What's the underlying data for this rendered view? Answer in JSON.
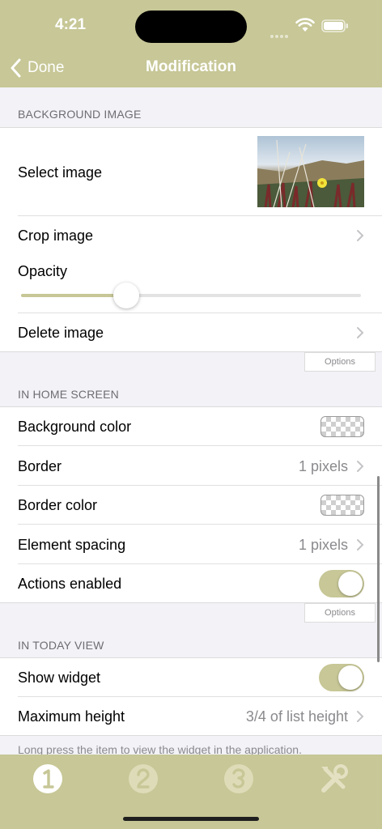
{
  "status_bar": {
    "time": "4:21"
  },
  "nav": {
    "back_label": "Done",
    "title": "Modification"
  },
  "background_image": {
    "header": "BACKGROUND IMAGE",
    "select_label": "Select image",
    "crop_label": "Crop image",
    "opacity_label": "Opacity",
    "opacity_value": 0.31,
    "delete_label": "Delete image",
    "options_label": "Options"
  },
  "home_screen": {
    "header": "IN HOME SCREEN",
    "background_color_label": "Background color",
    "border_label": "Border",
    "border_value": "1 pixels",
    "border_color_label": "Border color",
    "spacing_label": "Element spacing",
    "spacing_value": "1 pixels",
    "actions_label": "Actions enabled",
    "actions_enabled": true,
    "options_label": "Options"
  },
  "today_view": {
    "header": "IN TODAY VIEW",
    "show_widget_label": "Show widget",
    "show_widget": true,
    "max_height_label": "Maximum height",
    "max_height_value": "3/4 of list height",
    "note": "Long press the item to view the widget in the application."
  },
  "tabbar": {
    "tabs": [
      {
        "icon": "number-1-icon",
        "selected": true
      },
      {
        "icon": "number-2-icon",
        "selected": false
      },
      {
        "icon": "number-3-icon",
        "selected": false
      },
      {
        "icon": "tools-icon",
        "selected": false
      }
    ]
  },
  "colors": {
    "accent": "#c7c797",
    "background": "#f2f2f7"
  }
}
